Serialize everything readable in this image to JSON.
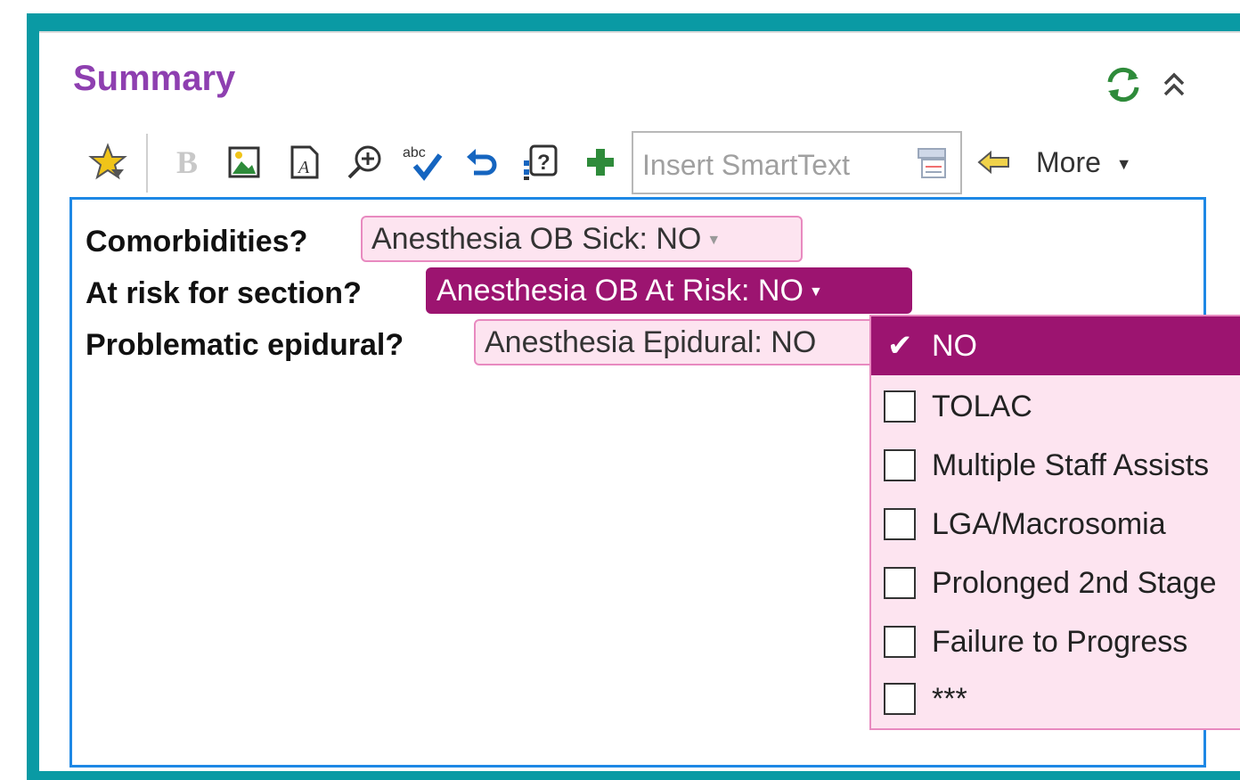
{
  "header": {
    "title": "Summary",
    "refresh_icon": "refresh-icon",
    "collapse_icon": "double-chevron-up-icon"
  },
  "toolbar": {
    "icons": [
      "star-icon",
      "bold-icon",
      "image-icon",
      "document-icon",
      "zoom-in-icon",
      "spell-check-icon",
      "undo-icon",
      "help-field-icon",
      "add-icon"
    ],
    "smarttext_placeholder": "Insert SmartText",
    "more_label": "More",
    "colors": {
      "add": "#2e8b3a",
      "undo": "#1565c0",
      "star": "#f0c419"
    }
  },
  "editor": {
    "lines": [
      {
        "label": "Comorbidities?",
        "chip": "Anesthesia OB Sick: NO"
      },
      {
        "label": "At risk for section?",
        "chip": "Anesthesia OB At Risk: NO"
      },
      {
        "label": "Problematic epidural?",
        "chip": "Anesthesia Epidural: NO"
      }
    ]
  },
  "dropdown": {
    "options": [
      {
        "label": "NO",
        "checked": true
      },
      {
        "label": "TOLAC",
        "checked": false
      },
      {
        "label": "Multiple Staff Assists",
        "checked": false
      },
      {
        "label": "LGA/Macrosomia",
        "checked": false
      },
      {
        "label": "Prolonged 2nd Stage",
        "checked": false
      },
      {
        "label": "Failure to Progress",
        "checked": false
      },
      {
        "label": "***",
        "checked": false
      }
    ]
  },
  "colors": {
    "frame": "#0a9aa4",
    "title": "#8e3fb0",
    "chip_bg": "#fde4f0",
    "chip_border": "#e88ac0",
    "chip_active": "#9c1470",
    "editor_border": "#1e88e5"
  }
}
